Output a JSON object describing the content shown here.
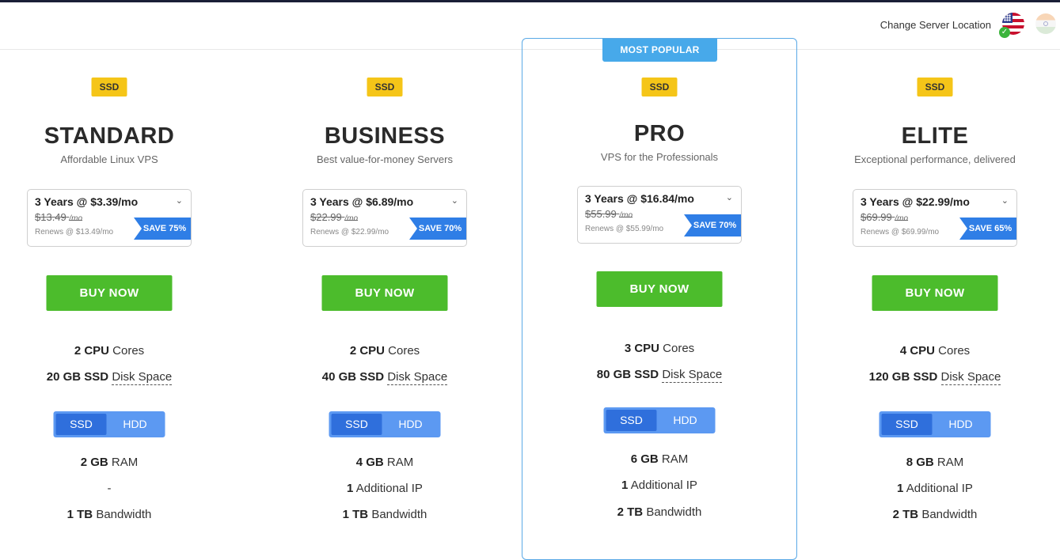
{
  "header": {
    "change_location_label": "Change Server Location",
    "flags": [
      "us-flag-icon",
      "india-flag-icon"
    ]
  },
  "popular_label": "MOST POPULAR",
  "plans": [
    {
      "badge": "SSD",
      "name": "STANDARD",
      "subtitle": "Affordable Linux VPS",
      "term_price": "3 Years @ $3.39/mo",
      "old_price": "$13.49",
      "old_unit": "/mo",
      "renews": "Renews @ $13.49/mo",
      "save": "SAVE 75%",
      "buy_label": "BUY NOW",
      "cpu_value": "2 CPU",
      "cpu_label": "Cores",
      "disk_value": "20 GB SSD",
      "disk_label": "Disk Space",
      "toggle_ssd": "SSD",
      "toggle_hdd": "HDD",
      "ram_value": "2 GB",
      "ram_label": "RAM",
      "ip_value": "",
      "ip_label": "-",
      "bw_value": "1 TB",
      "bw_label": "Bandwidth"
    },
    {
      "badge": "SSD",
      "name": "BUSINESS",
      "subtitle": "Best value-for-money Servers",
      "term_price": "3 Years @ $6.89/mo",
      "old_price": "$22.99",
      "old_unit": "/mo",
      "renews": "Renews @ $22.99/mo",
      "save": "SAVE 70%",
      "buy_label": "BUY NOW",
      "cpu_value": "2 CPU",
      "cpu_label": "Cores",
      "disk_value": "40 GB SSD",
      "disk_label": "Disk Space",
      "toggle_ssd": "SSD",
      "toggle_hdd": "HDD",
      "ram_value": "4 GB",
      "ram_label": "RAM",
      "ip_value": "1",
      "ip_label": "Additional IP",
      "bw_value": "1 TB",
      "bw_label": "Bandwidth"
    },
    {
      "badge": "SSD",
      "name": "PRO",
      "subtitle": "VPS for the Professionals",
      "term_price": "3 Years @ $16.84/mo",
      "old_price": "$55.99",
      "old_unit": "/mo",
      "renews": "Renews @ $55.99/mo",
      "save": "SAVE 70%",
      "buy_label": "BUY NOW",
      "cpu_value": "3 CPU",
      "cpu_label": "Cores",
      "disk_value": "80 GB SSD",
      "disk_label": "Disk Space",
      "toggle_ssd": "SSD",
      "toggle_hdd": "HDD",
      "ram_value": "6 GB",
      "ram_label": "RAM",
      "ip_value": "1",
      "ip_label": "Additional IP",
      "bw_value": "2 TB",
      "bw_label": "Bandwidth"
    },
    {
      "badge": "SSD",
      "name": "ELITE",
      "subtitle": "Exceptional performance, delivered",
      "term_price": "3 Years @ $22.99/mo",
      "old_price": "$69.99",
      "old_unit": "/mo",
      "renews": "Renews @ $69.99/mo",
      "save": "SAVE 65%",
      "buy_label": "BUY NOW",
      "cpu_value": "4 CPU",
      "cpu_label": "Cores",
      "disk_value": "120 GB SSD",
      "disk_label": "Disk Space",
      "toggle_ssd": "SSD",
      "toggle_hdd": "HDD",
      "ram_value": "8 GB",
      "ram_label": "RAM",
      "ip_value": "1",
      "ip_label": "Additional IP",
      "bw_value": "2 TB",
      "bw_label": "Bandwidth"
    }
  ]
}
